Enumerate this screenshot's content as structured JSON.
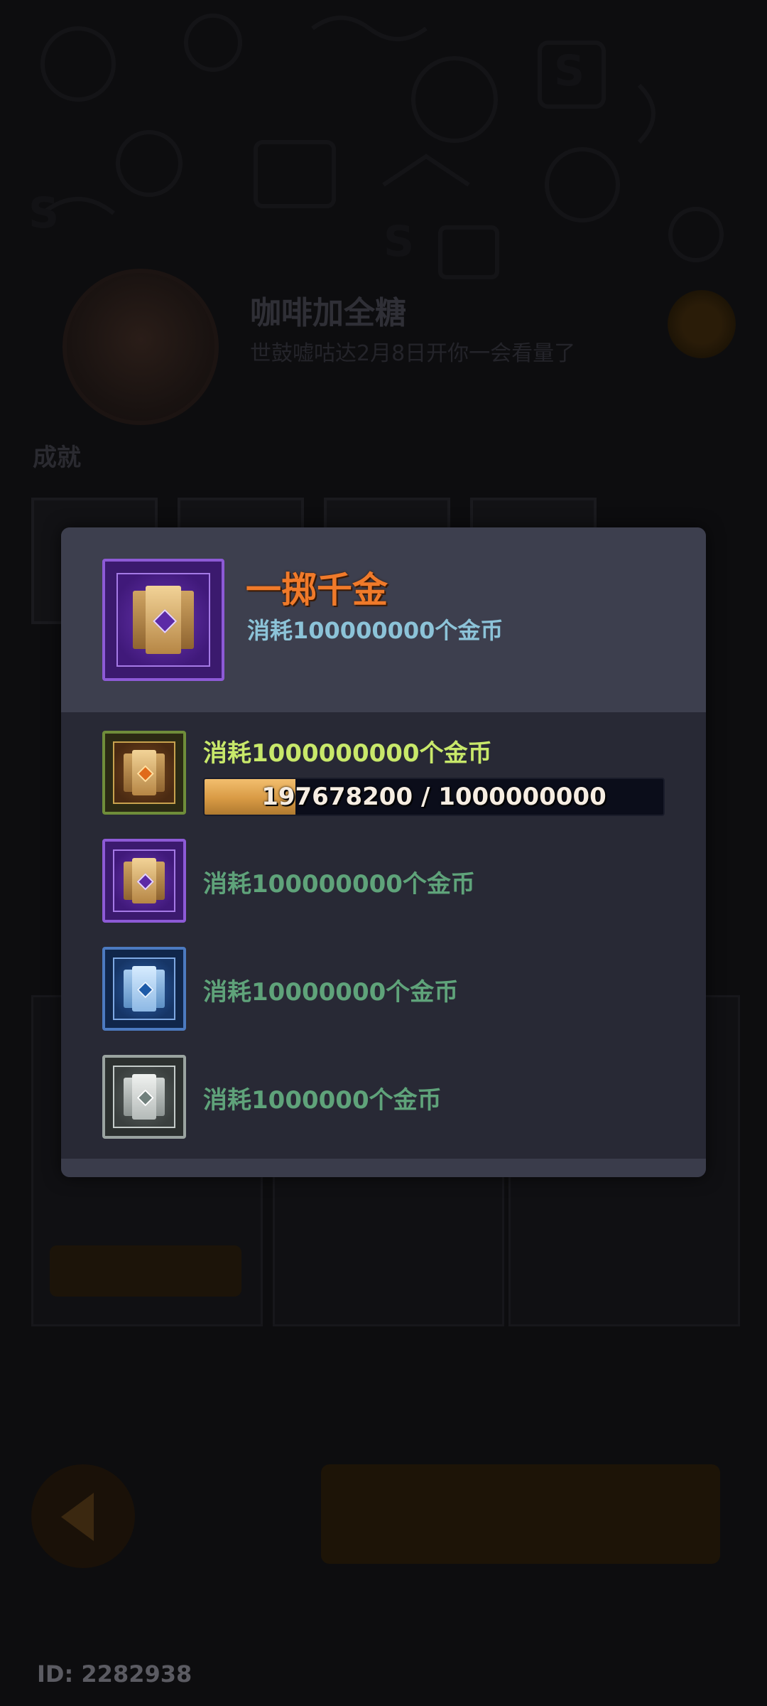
{
  "background": {
    "profile": {
      "name": "咖啡加全糖",
      "subtitle": "世鼓嘘咕达2月8日开你一会看量了"
    },
    "achievements_label": "成就",
    "user_id": "ID: 2282938"
  },
  "popup": {
    "title": "一掷千金",
    "subtitle": "消耗100000000个金币",
    "tiers": [
      {
        "label": "消耗1000000000个金币",
        "tier": "gold",
        "active": true,
        "progress": {
          "current": 197678200,
          "target": 1000000000,
          "text": "197678200 / 1000000000"
        }
      },
      {
        "label": "消耗100000000个金币",
        "tier": "purple",
        "active": false
      },
      {
        "label": "消耗10000000个金币",
        "tier": "blue",
        "active": false
      },
      {
        "label": "消耗1000000个金币",
        "tier": "silver",
        "active": false
      }
    ]
  },
  "colors": {
    "title_orange": "#f07a2a",
    "active_label": "#c8e86a",
    "inactive_label": "#5fa37a",
    "subtitle_blue": "#8cc3d8"
  },
  "icons": {
    "header_badge": "purple-card-badge-icon",
    "tier_badges": [
      "gold-card-badge-icon",
      "purple-card-badge-icon",
      "blue-card-badge-icon",
      "silver-card-badge-icon"
    ],
    "settings": "gear-icon",
    "back": "back-arrow-icon"
  }
}
